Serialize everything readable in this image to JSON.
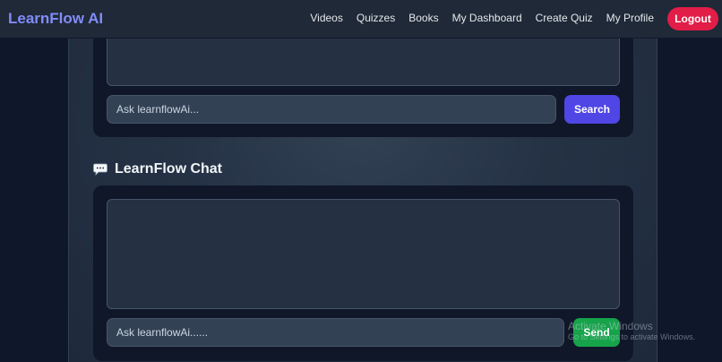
{
  "navbar": {
    "brand": "LearnFlow AI",
    "links": [
      "Videos",
      "Quizzes",
      "Books",
      "My Dashboard",
      "Create Quiz",
      "My Profile"
    ],
    "logout_label": "Logout"
  },
  "search_section": {
    "input_placeholder": "Ask learnflowAi...",
    "button_label": "Search"
  },
  "chat_section": {
    "heading": "LearnFlow Chat",
    "icon": "speech-bubble-icon",
    "input_placeholder": "Ask learnflowAi......",
    "button_label": "Send"
  },
  "watermark": {
    "title": "Activate Windows",
    "subtitle": "Go to Settings to activate Windows."
  },
  "colors": {
    "brand": "#818cf8",
    "logout": "#e11d48",
    "search_button": "#4f46e5",
    "send_button": "#16a34a"
  }
}
